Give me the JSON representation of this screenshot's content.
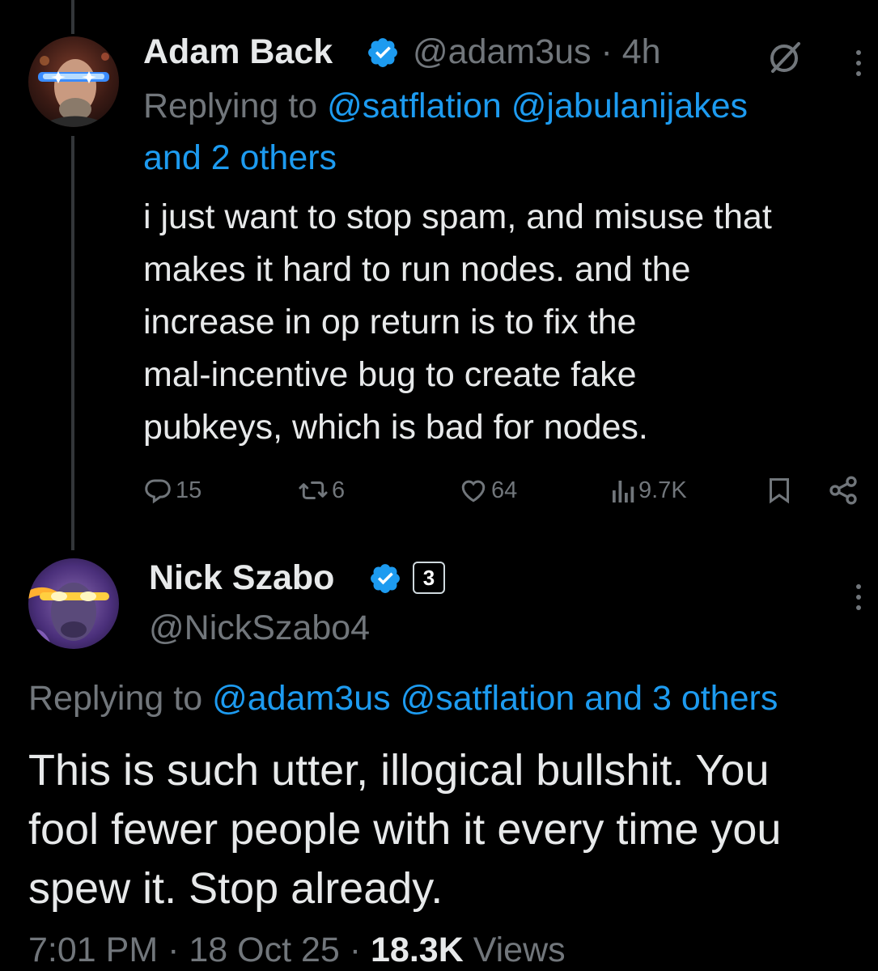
{
  "tweet1": {
    "name": "Adam Back",
    "handle_time": "@adam3us · 4h",
    "reply_prefix": "Replying to ",
    "reply_mentions": "@satflation @jabulanijakes",
    "reply_more": "and 2 others",
    "body_lines": [
      "i just want to stop spam, and misuse that",
      "makes it hard to run nodes. and the",
      "increase in op return is to fix the",
      "mal-incentive bug to create fake",
      "pubkeys, which is bad for nodes."
    ],
    "actions": {
      "replies": "15",
      "reposts": "6",
      "likes": "64",
      "views": "9.7K"
    }
  },
  "tweet2": {
    "name": "Nick Szabo",
    "affiliate_badge": "3",
    "handle": "@NickSzabo4",
    "reply_prefix": "Replying to ",
    "reply_mentions": "@adam3us @satflation and 3 others",
    "body_lines": [
      "This is such utter, illogical bullshit.  You",
      "fool fewer people with it every time you",
      "spew it.  Stop already."
    ],
    "timestamp": "7:01 PM · 18 Oct 25 · ",
    "views_count": "18.3K",
    "views_label": " Views"
  },
  "colors": {
    "background": "#000000",
    "text_primary": "#e7e9ea",
    "text_secondary": "#71767b",
    "accent_blue": "#1d9bf0",
    "thread_line": "#333639"
  },
  "icons": [
    "verified-badge-icon",
    "grok-icon",
    "more-options-icon",
    "reply-icon",
    "repost-icon",
    "like-icon",
    "views-icon",
    "bookmark-icon",
    "share-icon"
  ]
}
